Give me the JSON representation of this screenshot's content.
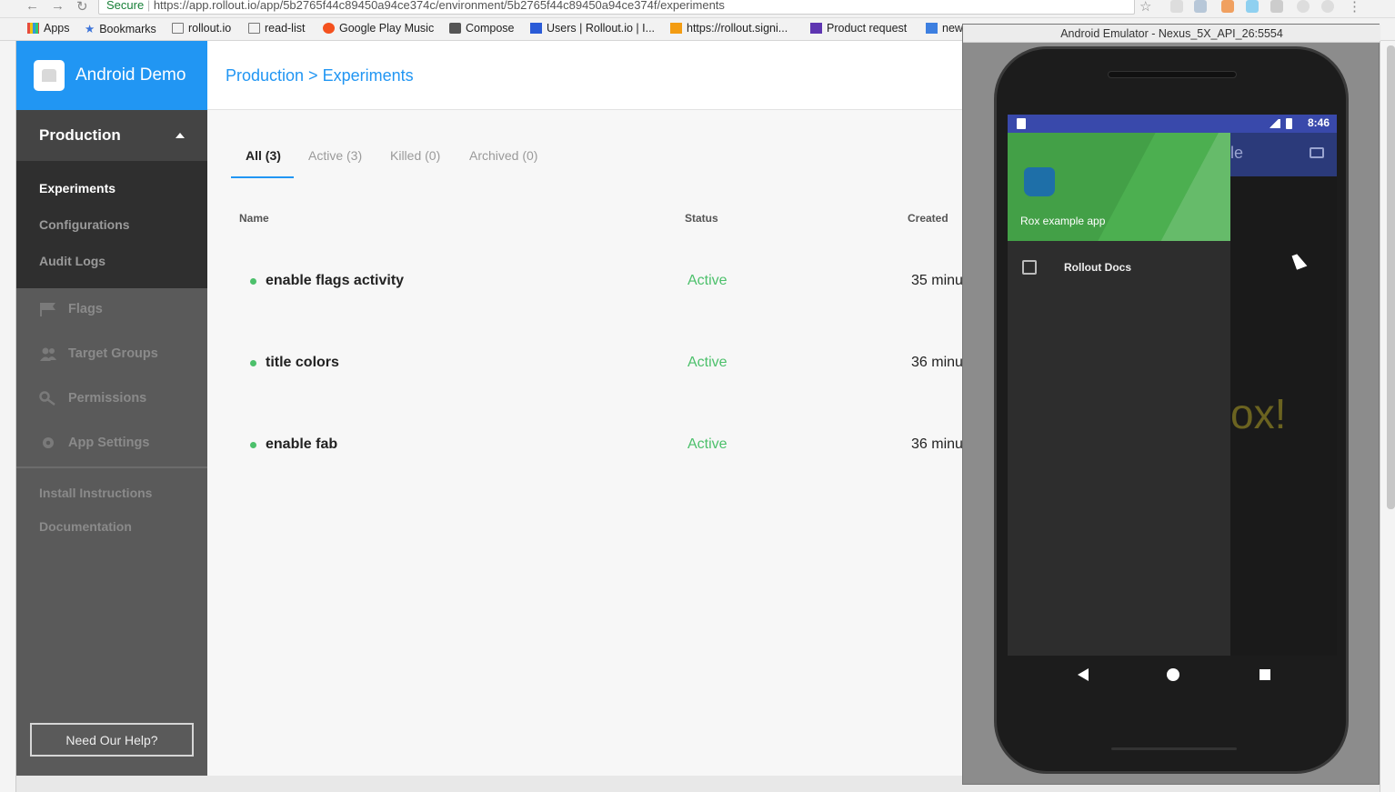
{
  "browser": {
    "secure_label": "Secure",
    "url": "https://app.rollout.io/app/5b2765f44c89450a94ce374c/environment/5b2765f44c89450a94ce374f/experiments",
    "bookmarks": [
      "Apps",
      "Bookmarks",
      "rollout.io",
      "read-list",
      "Google Play Music",
      "Compose",
      "Users | Rollout.io | I...",
      "https://rollout.signi...",
      "Product request",
      "new"
    ]
  },
  "sidebar": {
    "brand": "Android Demo",
    "environment": "Production",
    "env_items": [
      {
        "label": "Experiments"
      },
      {
        "label": "Configurations"
      },
      {
        "label": "Audit Logs"
      }
    ],
    "items": [
      {
        "label": "Flags",
        "icon": "flag-icon"
      },
      {
        "label": "Target Groups",
        "icon": "users-icon"
      },
      {
        "label": "Permissions",
        "icon": "key-icon"
      },
      {
        "label": "App Settings",
        "icon": "gear-icon"
      }
    ],
    "links": [
      "Install Instructions",
      "Documentation"
    ],
    "help_button": "Need Our Help?"
  },
  "main": {
    "breadcrumb": "Production > Experiments",
    "tabs": [
      "All (3)",
      "Active (3)",
      "Killed (0)",
      "Archived (0)"
    ],
    "columns": [
      "Name",
      "Status",
      "Created"
    ],
    "rows": [
      {
        "name": "enable flags activity",
        "status": "Active",
        "created": "35 minu"
      },
      {
        "name": "title colors",
        "status": "Active",
        "created": "36 minu"
      },
      {
        "name": "enable fab",
        "status": "Active",
        "created": "36 minu"
      }
    ]
  },
  "emulator": {
    "title": "Android Emulator - Nexus_5X_API_26:5554",
    "time": "8:46",
    "toolbar_text": "le",
    "background_text": "ox!",
    "drawer_title": "Rox example app",
    "drawer_item": "Rollout Docs"
  },
  "colors": {
    "accent": "#2196f3",
    "active": "#4cc06b",
    "drawer_header": "#43a047",
    "statusbar": "#3949ab"
  }
}
